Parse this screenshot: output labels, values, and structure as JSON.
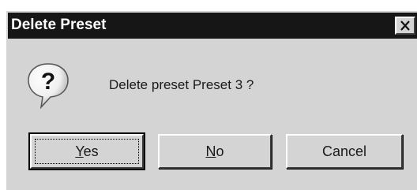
{
  "dialog": {
    "title": "Delete Preset",
    "close_icon": "close-icon",
    "icon": "question-icon",
    "message": "Delete preset Preset 3 ?",
    "buttons": {
      "yes": {
        "mnemonic": "Y",
        "rest": "es"
      },
      "no": {
        "mnemonic": "N",
        "rest": "o"
      },
      "cancel": {
        "label": "Cancel"
      }
    },
    "default_button": "yes"
  },
  "colors": {
    "titlebar": "#161616",
    "title_text": "#ffffff",
    "dialog_face": "#d4d4d4"
  }
}
